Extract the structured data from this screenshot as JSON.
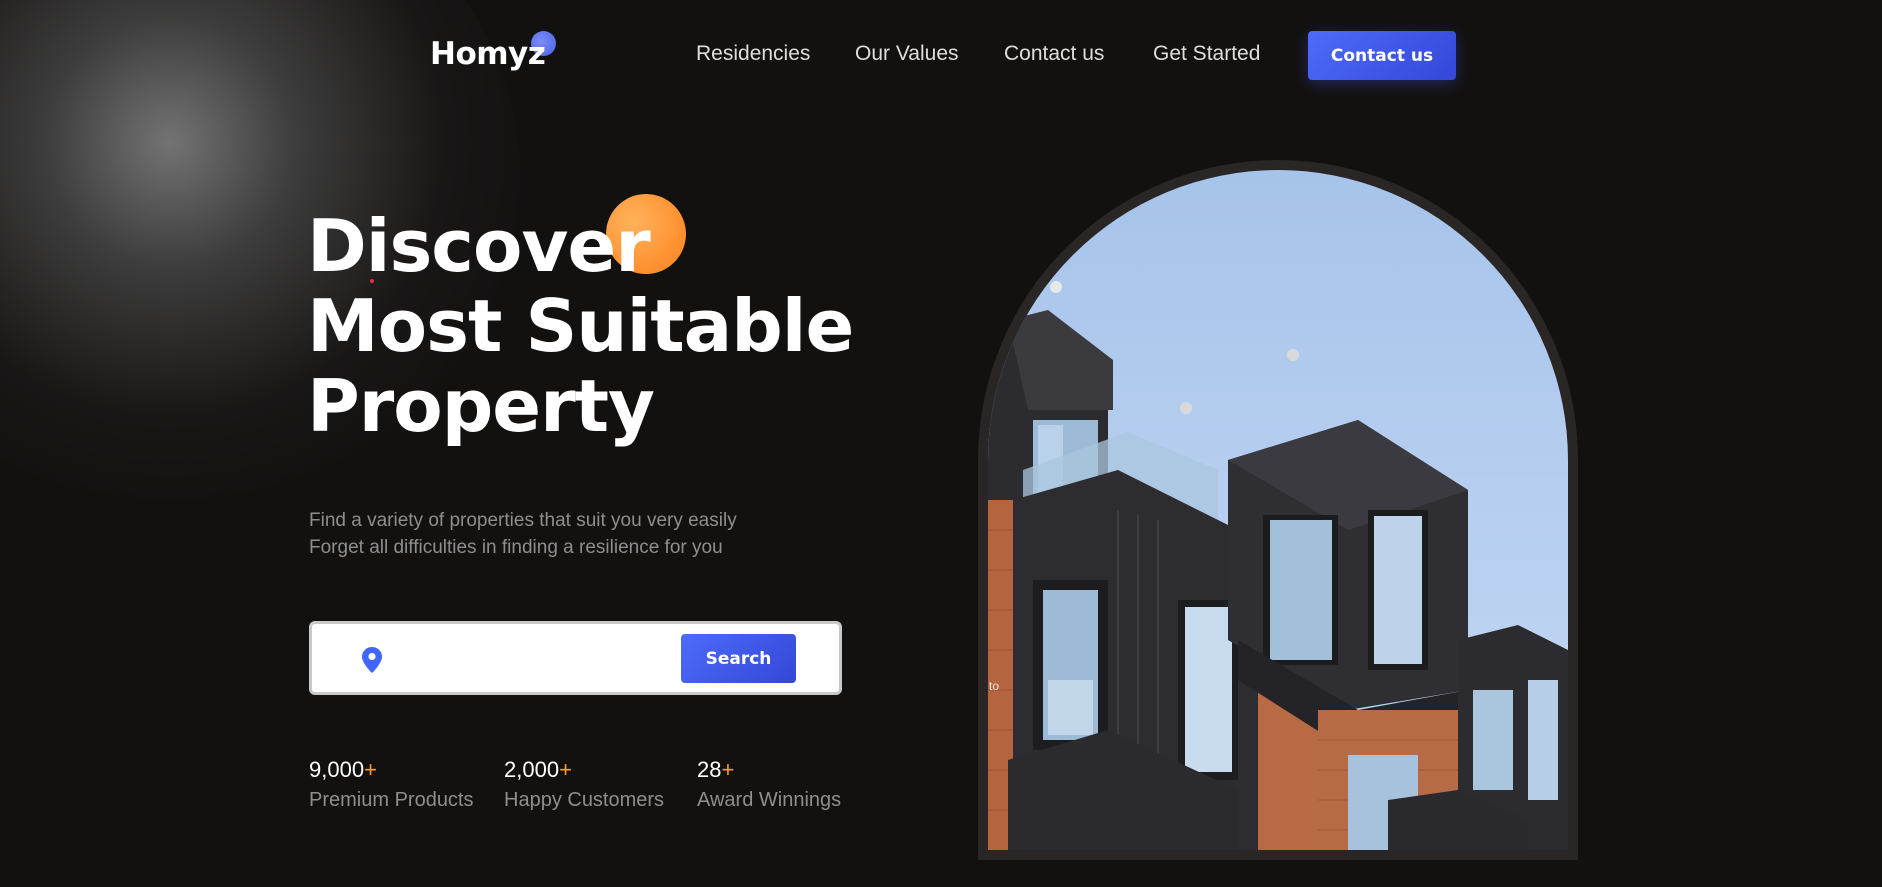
{
  "header": {
    "logo": "Homyz",
    "nav": [
      {
        "label": "Residencies"
      },
      {
        "label": "Our Values"
      },
      {
        "label": "Contact us"
      },
      {
        "label": "Get Started"
      }
    ],
    "cta_label": "Contact us"
  },
  "hero": {
    "title_lines": [
      "Discover",
      "Most Suitable",
      "Property"
    ],
    "subtitle_lines": [
      "Find a variety of properties that suit you very easily",
      "Forget all difficulties in finding a resilience for you"
    ],
    "search": {
      "placeholder": "",
      "button_label": "Search"
    },
    "stats": [
      {
        "value": "9,000",
        "plus": "+",
        "label": "Premium Products"
      },
      {
        "value": "2,000",
        "plus": "+",
        "label": "Happy Customers"
      },
      {
        "value": "28",
        "plus": "+",
        "label": "Award Winnings"
      }
    ],
    "image_caption": "to"
  },
  "colors": {
    "background": "#131110",
    "accent_blue": "#4066ff",
    "accent_orange": "#ff9a2f"
  },
  "icons": {
    "location": "location-pin-icon"
  }
}
